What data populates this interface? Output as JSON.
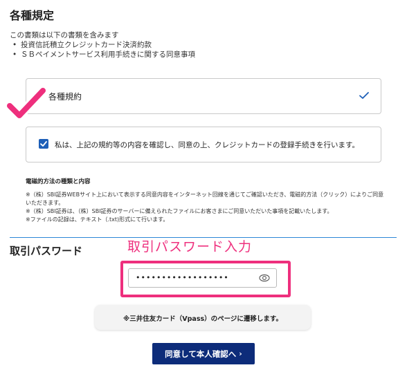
{
  "section": {
    "title": "各種規定"
  },
  "intro": {
    "lead": "この書類は以下の書類を含みます",
    "items": [
      "投資信託積立クレジットカード決済約款",
      "ＳＢペイメントサービス利用手続きに関する同意事項"
    ]
  },
  "documents": {
    "label": "各種規約"
  },
  "agreement": {
    "text": "私は、上記の規約等の内容を確認し、同意の上、クレジットカードの登録手続きを行います。",
    "checked": true
  },
  "notes": {
    "title": "電磁的方法の種類と内容",
    "lines": [
      "※（株）SBI証券WEBサイト上において表示する同意内容をインターネット回線を通じてご確認いただき、電磁的方法（クリック）によりご同意いただきます。",
      "※（株）SBI証券は、（株）SBI証券のサーバーに備えられたファイルにお客さまにご同意いただいた事項を記載いたします。",
      "※ファイルの記録は、テキスト（.txt)形式にて行います。"
    ]
  },
  "password": {
    "title": "取引パスワード",
    "annotation": "取引パスワード入力",
    "masked_value": "••••••••••••••••••"
  },
  "notice": {
    "text": "※三井住友カード（Vpass）のページに遷移します。"
  },
  "submit": {
    "label": "同意して本人確認へ",
    "arrow": "›"
  },
  "colors": {
    "accent": "#1d5fb8",
    "button": "#0d2c7a",
    "annotation": "#ee2f7d",
    "divider": "#2b86d6"
  },
  "icons": {
    "doc_check": "check-icon",
    "eye": "eye-icon",
    "annotation": "big-checkmark-icon"
  }
}
